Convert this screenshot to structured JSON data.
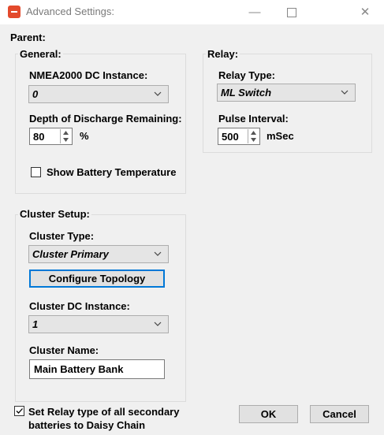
{
  "window": {
    "title": "Advanced Settings:",
    "minimize": "—",
    "close": "✕"
  },
  "parent_label": "Parent:",
  "general": {
    "title": "General:",
    "nmea_label": "NMEA2000 DC Instance:",
    "nmea_value": "0",
    "dod_label": "Depth of Discharge Remaining:",
    "dod_value": "80",
    "dod_unit": "%",
    "show_temp_label": "Show Battery Temperature",
    "show_temp_checked": false
  },
  "relay": {
    "title": "Relay:",
    "type_label": "Relay Type:",
    "type_value": "ML Switch",
    "pulse_label": "Pulse Interval:",
    "pulse_value": "500",
    "pulse_unit": "mSec"
  },
  "cluster": {
    "title": "Cluster Setup:",
    "type_label": "Cluster Type:",
    "type_value": "Cluster Primary",
    "configure_button": "Configure Topology",
    "dc_label": "Cluster DC Instance:",
    "dc_value": "1",
    "name_label": "Cluster Name:",
    "name_value": "Main Battery Bank"
  },
  "footer": {
    "daisy_line1": "Set Relay type of all secondary",
    "daisy_line2": "batteries to Daisy Chain",
    "daisy_checked": true,
    "ok_label": "OK",
    "cancel_label": "Cancel"
  }
}
